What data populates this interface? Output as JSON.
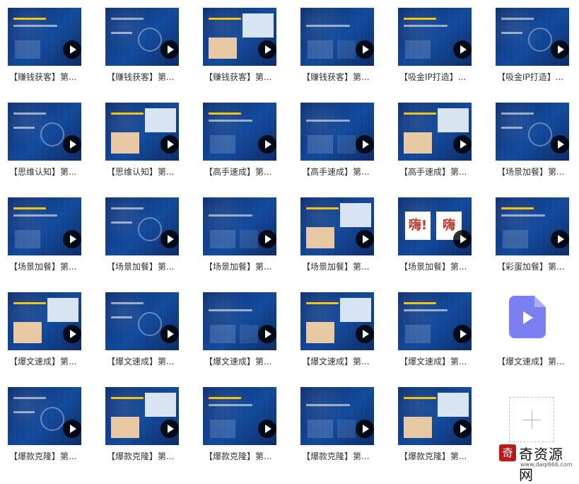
{
  "grid": {
    "items": [
      {
        "label": "【赚钱获客】第...",
        "style": "v1"
      },
      {
        "label": "【赚钱获客】第...",
        "style": "v2"
      },
      {
        "label": "【赚钱获客】第...",
        "style": "v3"
      },
      {
        "label": "【赚钱获客】第...",
        "style": "v4"
      },
      {
        "label": "【吸金IP打造】...",
        "style": "v1"
      },
      {
        "label": "【吸金IP打造】...",
        "style": "v2"
      },
      {
        "label": "【思维认知】第...",
        "style": "v2"
      },
      {
        "label": "【思维认知】第...",
        "style": "v3"
      },
      {
        "label": "【高手速成】第...",
        "style": "v1"
      },
      {
        "label": "【高手速成】第...",
        "style": "v4"
      },
      {
        "label": "【高手速成】第...",
        "style": "v3"
      },
      {
        "label": "【场景加餐】第...",
        "style": "v2"
      },
      {
        "label": "【场景加餐】第...",
        "style": "v1"
      },
      {
        "label": "【场景加餐】第...",
        "style": "v2"
      },
      {
        "label": "【场景加餐】第...",
        "style": "v4"
      },
      {
        "label": "【场景加餐】第...",
        "style": "v3"
      },
      {
        "label": "【场景加餐】第...",
        "style": "v5"
      },
      {
        "label": "【彩蛋加餐】第...",
        "style": "v1"
      },
      {
        "label": "【爆文速成】第...",
        "style": "v3"
      },
      {
        "label": "【爆文速成】第...",
        "style": "v2"
      },
      {
        "label": "【爆文速成】第...",
        "style": "v4"
      },
      {
        "label": "【爆文速成】第...",
        "style": "v3"
      },
      {
        "label": "【爆文速成】第...",
        "style": "v1"
      },
      {
        "label": "【爆文速成】第...",
        "style": "file"
      },
      {
        "label": "【爆款克隆】第...",
        "style": "v2"
      },
      {
        "label": "【爆款克隆】第...",
        "style": "v3"
      },
      {
        "label": "【爆款克隆】第...",
        "style": "v1"
      },
      {
        "label": "【爆款克隆】第...",
        "style": "v4"
      },
      {
        "label": "【爆款克隆】第...",
        "style": "v3"
      }
    ]
  },
  "icons": {
    "play": "play-icon",
    "file": "video-file-icon",
    "add": "plus-icon"
  },
  "watermark": {
    "seal": "奇",
    "name": "奇资源网",
    "url": "www.daqi666.com"
  },
  "colors": {
    "thumb_bg": "#134a9c",
    "play_bg": "#111111",
    "file_icon": "#7b7ff2"
  }
}
